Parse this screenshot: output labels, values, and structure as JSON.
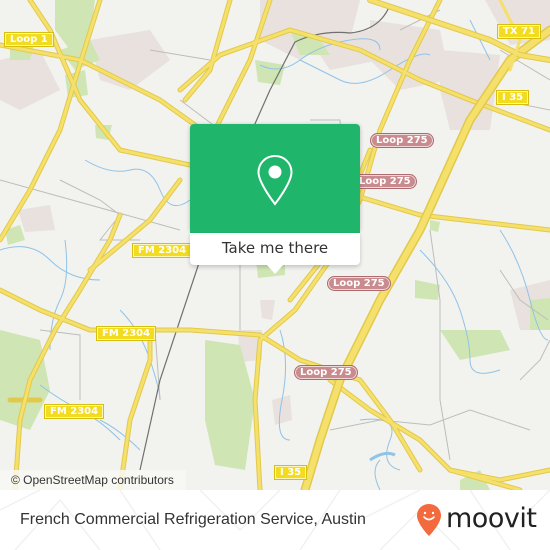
{
  "map": {
    "colors": {
      "land": "#f2f2ee",
      "urban": "#e8e1de",
      "park": "#cfe6b4",
      "water": "#8fc3e8",
      "road_major": "#f4e06b",
      "road_major_casing": "#e2c94a",
      "road_minor": "#bdbdbd",
      "rail": "#707070"
    },
    "shields": [
      {
        "label": "Loop 1",
        "style": "yellow"
      },
      {
        "label": "TX 71",
        "style": "yellow"
      },
      {
        "label": "I 35",
        "style": "yellow"
      },
      {
        "label": "Loop 275",
        "style": "red"
      },
      {
        "label": "Loop 275",
        "style": "red"
      },
      {
        "label": "FM 2304",
        "style": "yellow"
      },
      {
        "label": "Loop 275",
        "style": "red"
      },
      {
        "label": "FM 2304",
        "style": "yellow"
      },
      {
        "label": "Loop 275",
        "style": "red"
      },
      {
        "label": "FM 2304",
        "style": "yellow"
      },
      {
        "label": "I 35",
        "style": "yellow"
      }
    ],
    "attribution": "© OpenStreetMap contributors"
  },
  "popup": {
    "icon": "map-pin-icon",
    "button_label": "Take me there",
    "color": "#1fb66b"
  },
  "footer": {
    "place_name": "French Commercial Refrigeration Service, Austin",
    "brand": "moovit",
    "brand_icon": "moovit-pin-smile-icon",
    "brand_color": "#f26a3d"
  }
}
